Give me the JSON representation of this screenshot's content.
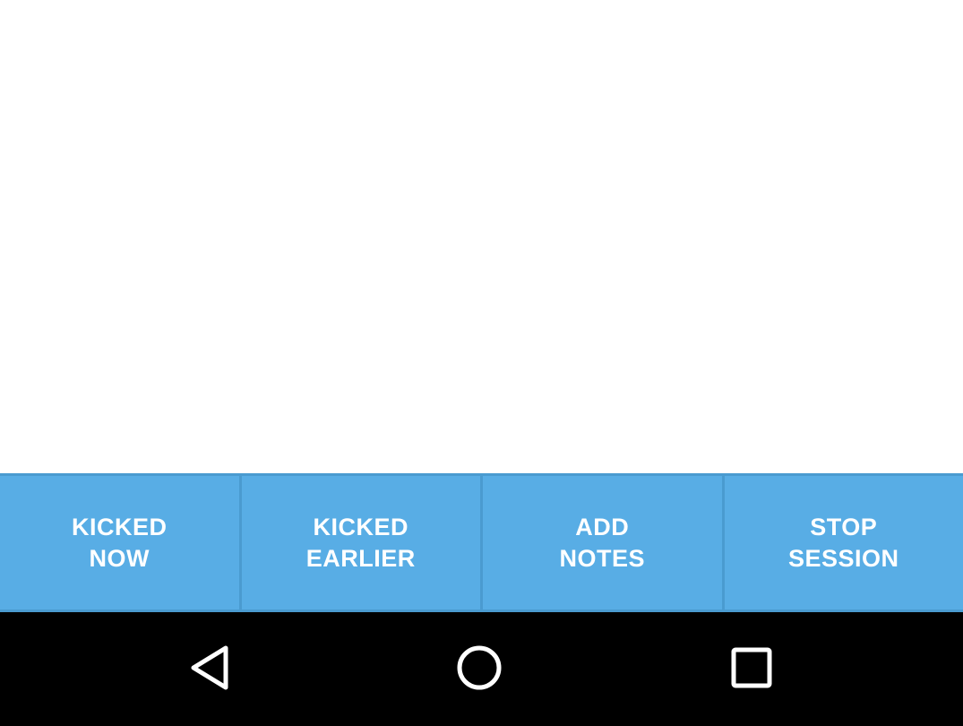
{
  "action_bar": {
    "buttons": [
      {
        "line1": "KICKED",
        "line2": "NOW"
      },
      {
        "line1": "KICKED",
        "line2": "EARLIER"
      },
      {
        "line1": "ADD",
        "line2": "NOTES"
      },
      {
        "line1": "STOP",
        "line2": "SESSION"
      }
    ],
    "background_color": "#58ade5",
    "divider_color": "#4a9bd0",
    "text_color": "#ffffff"
  },
  "nav_bar": {
    "icons": [
      "back-icon",
      "home-icon",
      "recents-icon"
    ],
    "background_color": "#000000"
  }
}
